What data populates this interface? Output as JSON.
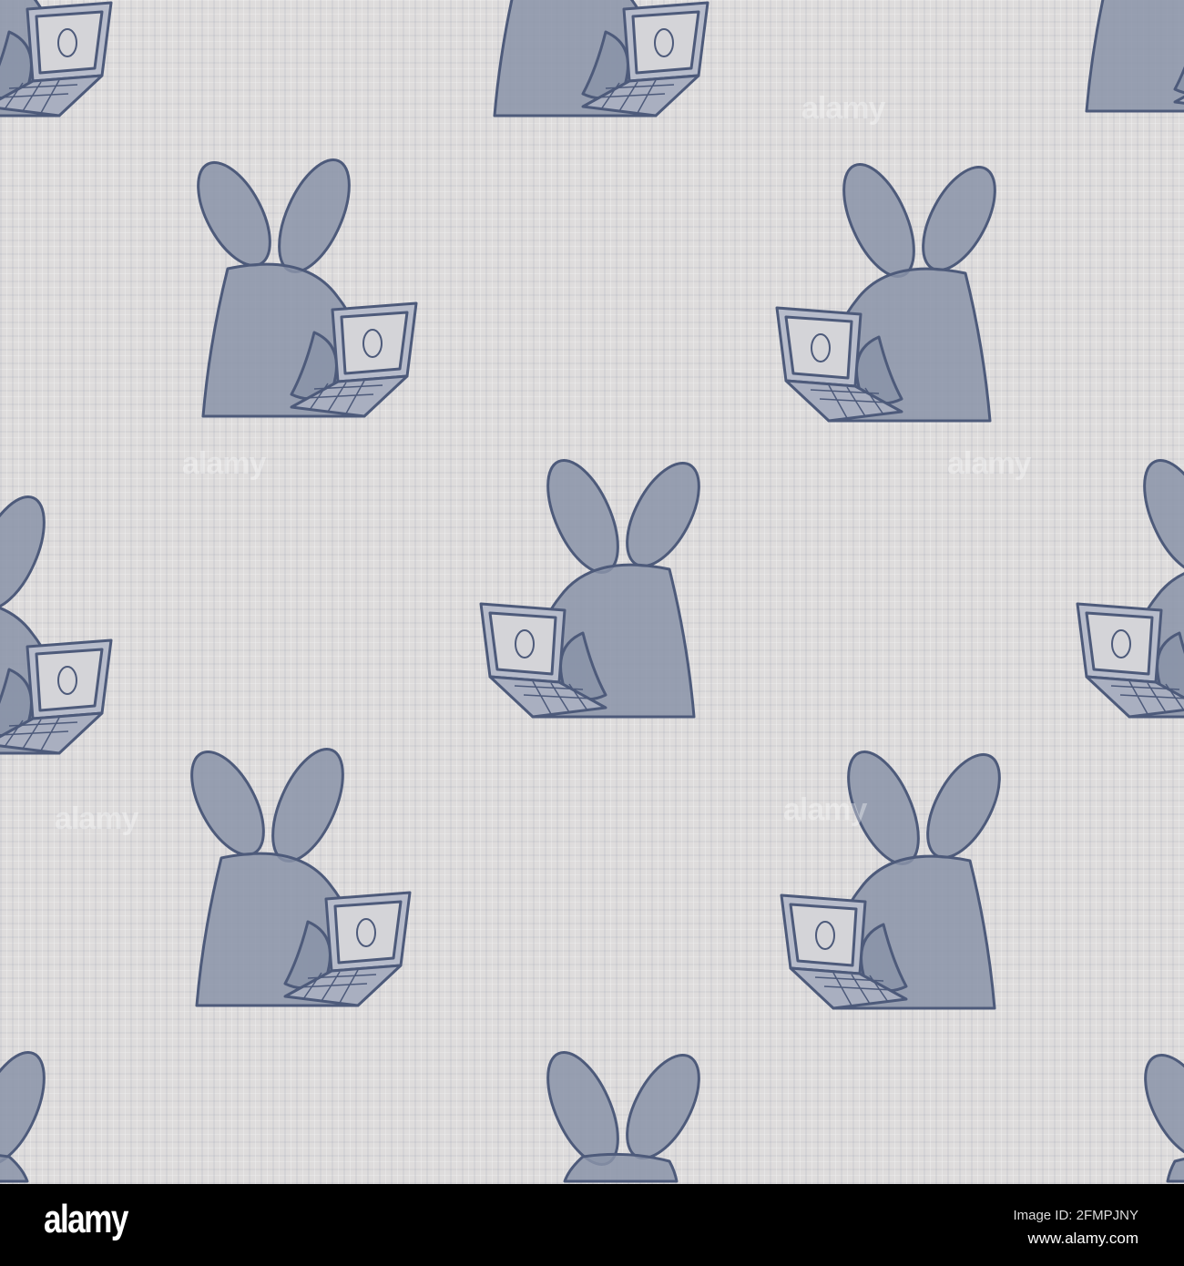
{
  "pattern": {
    "motif": "bunny-with-laptop",
    "colors": {
      "background": "#dedcdc",
      "fill": "#8a93a8",
      "stroke": "#4d5a7a",
      "screen": "#d4d4d8"
    },
    "watermark": "alamy"
  },
  "banner": {
    "logo": "alamy",
    "image_id": "Image ID: 2FMPJNY",
    "site": "www.alamy.com"
  }
}
